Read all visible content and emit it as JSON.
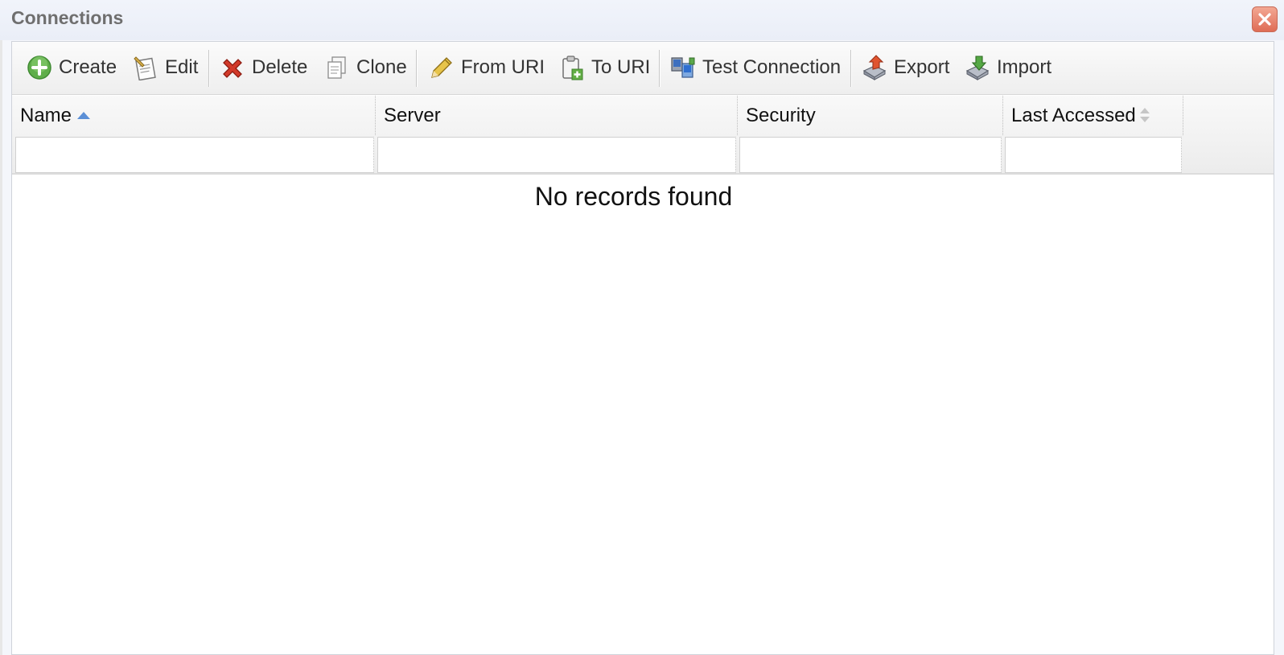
{
  "dialog": {
    "title": "Connections"
  },
  "toolbar": {
    "create": "Create",
    "edit": "Edit",
    "delete": "Delete",
    "clone": "Clone",
    "from_uri": "From URI",
    "to_uri": "To URI",
    "test_connection": "Test Connection",
    "export": "Export",
    "import": "Import"
  },
  "grid": {
    "columns": [
      {
        "label": "Name",
        "sort": "ascending"
      },
      {
        "label": "Server"
      },
      {
        "label": "Security"
      },
      {
        "label": "Last Accessed",
        "sort": "sortable"
      }
    ],
    "filters": [
      "",
      "",
      "",
      ""
    ],
    "empty_message": "No records found"
  },
  "colors": {
    "accent_sort": "#5b8fd6",
    "close_button": "#df6c55",
    "title_text": "#6f6f6f"
  }
}
